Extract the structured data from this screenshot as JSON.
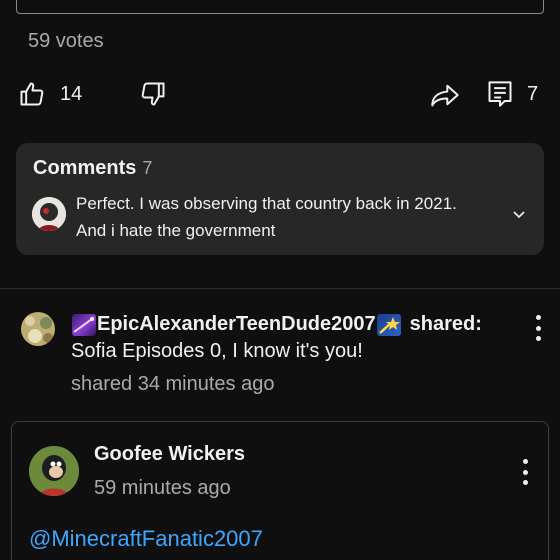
{
  "poll": {
    "votes_text": "59 votes"
  },
  "actions": {
    "like_count": "14",
    "comment_count": "7"
  },
  "comments": {
    "heading": "Comments",
    "count": "7",
    "preview_text": "Perfect. I was observing that country back in 2021. And i hate the government"
  },
  "share": {
    "username": "EpicAlexanderTeenDude2007",
    "verb": "shared:",
    "message": "Sofia Episodes 0, I know it's you!",
    "time": "shared 34 minutes ago"
  },
  "post": {
    "author": "Goofee Wickers",
    "time": "59 minutes ago",
    "mention": "@MinecraftFanatic2007"
  },
  "colors": {
    "background": "#0f0f0f",
    "card": "#272727",
    "link": "#3ea6ff",
    "secondary_text": "#aaaaaa"
  }
}
